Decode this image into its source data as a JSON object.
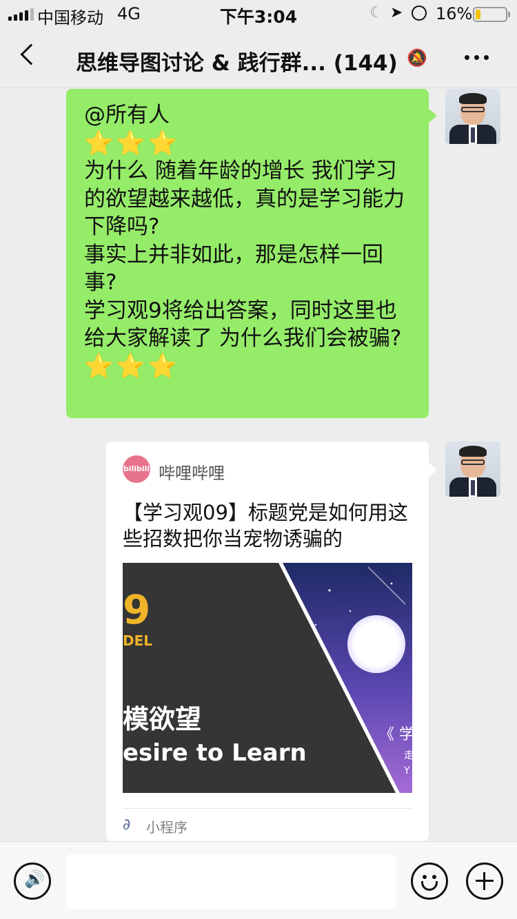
{
  "status_bar": {
    "carrier": "中国移动",
    "network": "4G",
    "time": "下午3:04",
    "battery_percent": "16%",
    "battery_level": 0.16,
    "icons": [
      "signal-icon",
      "moon-icon",
      "location-icon",
      "alarm-icon",
      "battery-icon"
    ]
  },
  "nav": {
    "title": "思维导图讨论 & 践行群... (144)",
    "icons": [
      "back-icon",
      "mute-bell-icon",
      "more-icon"
    ]
  },
  "messages": {
    "text_message": {
      "mention": "@所有人",
      "stars_top": "⭐⭐⭐",
      "body": "为什么 随着年龄的增长 我们学习的欲望越来越低，真的是学习能力下降吗?\n事实上并非如此，那是怎样一回事?\n学习观9将给出答案，同时这里也给大家解读了 为什么我们会被骗?",
      "stars_bottom": "⭐⭐⭐"
    },
    "share_card": {
      "source_logo_text": "bilibili",
      "source_name": "哔哩哔哩",
      "title": "【学习观09】标题党是如何用这些招数把你当宠物诱骗的",
      "thumb_text": {
        "number": "9",
        "model": "DEL",
        "cn": "模欲望",
        "en": "esire to Learn",
        "right_cn": "《 学",
        "right_small_1": "走",
        "right_small_2": "Y"
      },
      "footer_label": "小程序"
    }
  },
  "colors": {
    "chat_bg": "#ededed",
    "my_bubble": "#95ec69",
    "card_bg": "#ffffff",
    "bilibili_pink": "#e8738d",
    "link_blue": "#576b95",
    "thumb_accent": "#f0b429",
    "thumb_purple": "#6b4fb8"
  },
  "input_bar": {
    "icons": [
      "voice-icon",
      "emoji-icon",
      "plus-icon"
    ]
  }
}
